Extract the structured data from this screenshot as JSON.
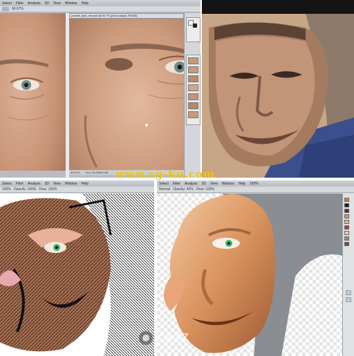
{
  "top_left": {
    "menus": [
      "Select",
      "Filter",
      "Analysis",
      "3D",
      "View",
      "Window",
      "Help"
    ],
    "doc_tabs": [
      "",
      "portrait_dyre_retouch @ 66.7% (photo adjust, RGB/8)"
    ],
    "zoom": "66.67%",
    "doc_info": "Doc: 25.0M/50.2M"
  },
  "bottom_left": {
    "menus": [
      "Select",
      "Filter",
      "Analysis",
      "3D",
      "View",
      "Window",
      "Help"
    ],
    "zoom": "100%",
    "options": [
      "Opacity: 100%",
      "Flow: 100%"
    ]
  },
  "bottom_right": {
    "menus": [
      "Select",
      "Filter",
      "Analysis",
      "3D",
      "View",
      "Window",
      "Help"
    ],
    "zoom": "100%",
    "options": [
      "Normal",
      "Opacity: 40%",
      "Flow: 100%"
    ]
  },
  "watermarks": {
    "site": "www.cg-ku.com",
    "brand": "ZAZZ"
  },
  "colors": {
    "skin_photo": "#c8987a",
    "poster_bg": "#c9a88a",
    "accent_yellow": "#f2c400",
    "iris_green": "#2fbf6a",
    "canvas_gray": "#8a8e92"
  }
}
